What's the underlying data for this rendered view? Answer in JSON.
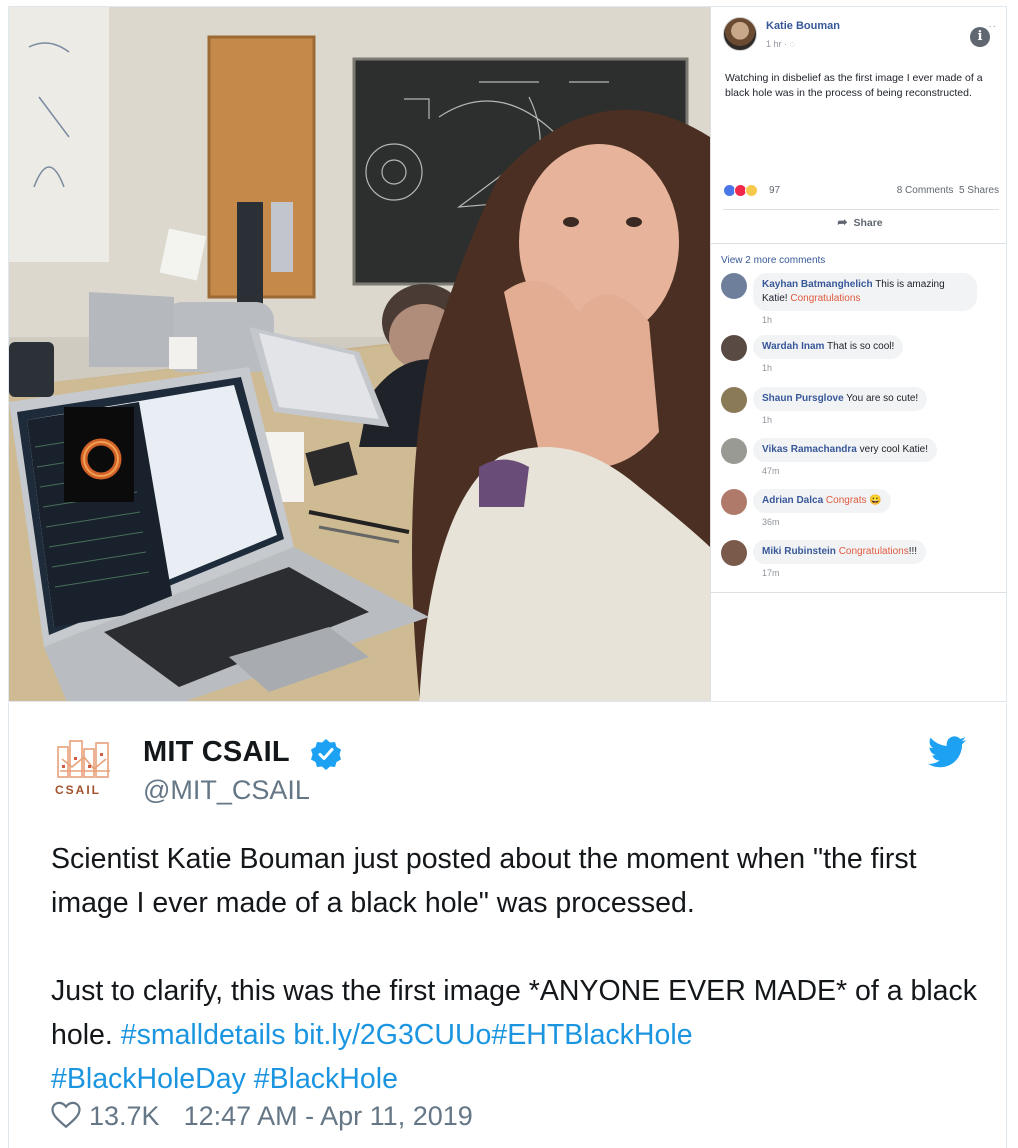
{
  "facebook_post": {
    "author": "Katie Bouman",
    "time": "1 hr · ◌",
    "more": "··",
    "info": "i",
    "text": "Watching in disbelief as the first image I ever made of a black hole was in the process of being reconstructed.",
    "reaction_count": "97",
    "comments_count": "8 Comments",
    "shares_count": "5 Shares",
    "share_label": "Share",
    "view_more": "View 2 more comments",
    "comments": [
      {
        "name": "Kayhan Batmanghelich",
        "text": "This is amazing",
        "text2": "Katie!",
        "highlight": "Congratulations",
        "time": "1h"
      },
      {
        "name": "Wardah Inam",
        "text": "That is so cool!",
        "time": "1h"
      },
      {
        "name": "Shaun Pursglove",
        "text": "You are so cute!",
        "time": "1h"
      },
      {
        "name": "Vikas Ramachandra",
        "text": "very cool Katie!",
        "time": "47m"
      },
      {
        "name": "Adrian Dalca",
        "highlight": "Congrats",
        "emoji": "😀",
        "time": "36m"
      },
      {
        "name": "Miki Rubinstein",
        "highlight": "Congratulations",
        "suffix": "!!!",
        "time": "17m"
      }
    ]
  },
  "tweet": {
    "logo_text": "CSAIL",
    "name": "MIT CSAIL",
    "handle": "@MIT_CSAIL",
    "text_line1": "Scientist Katie Bouman just posted about the moment when \"the first image I ever made of a black hole\" was processed.",
    "text_line2": "Just to clarify, this was the first image *ANYONE EVER MADE* of a black hole. ",
    "hashtag1": "#smalldetails",
    "link": "bit.ly/2G3CUUo",
    "hashtag2": "#EHTBlackHole",
    "hashtag3": "#BlackHoleDay",
    "hashtag4": "#BlackHole",
    "likes": "13.7K",
    "timestamp": "12:47 AM - Apr 11, 2019",
    "colors": {
      "link": "#1b95e0",
      "verified": "#1da1f2",
      "muted": "#657786"
    }
  }
}
